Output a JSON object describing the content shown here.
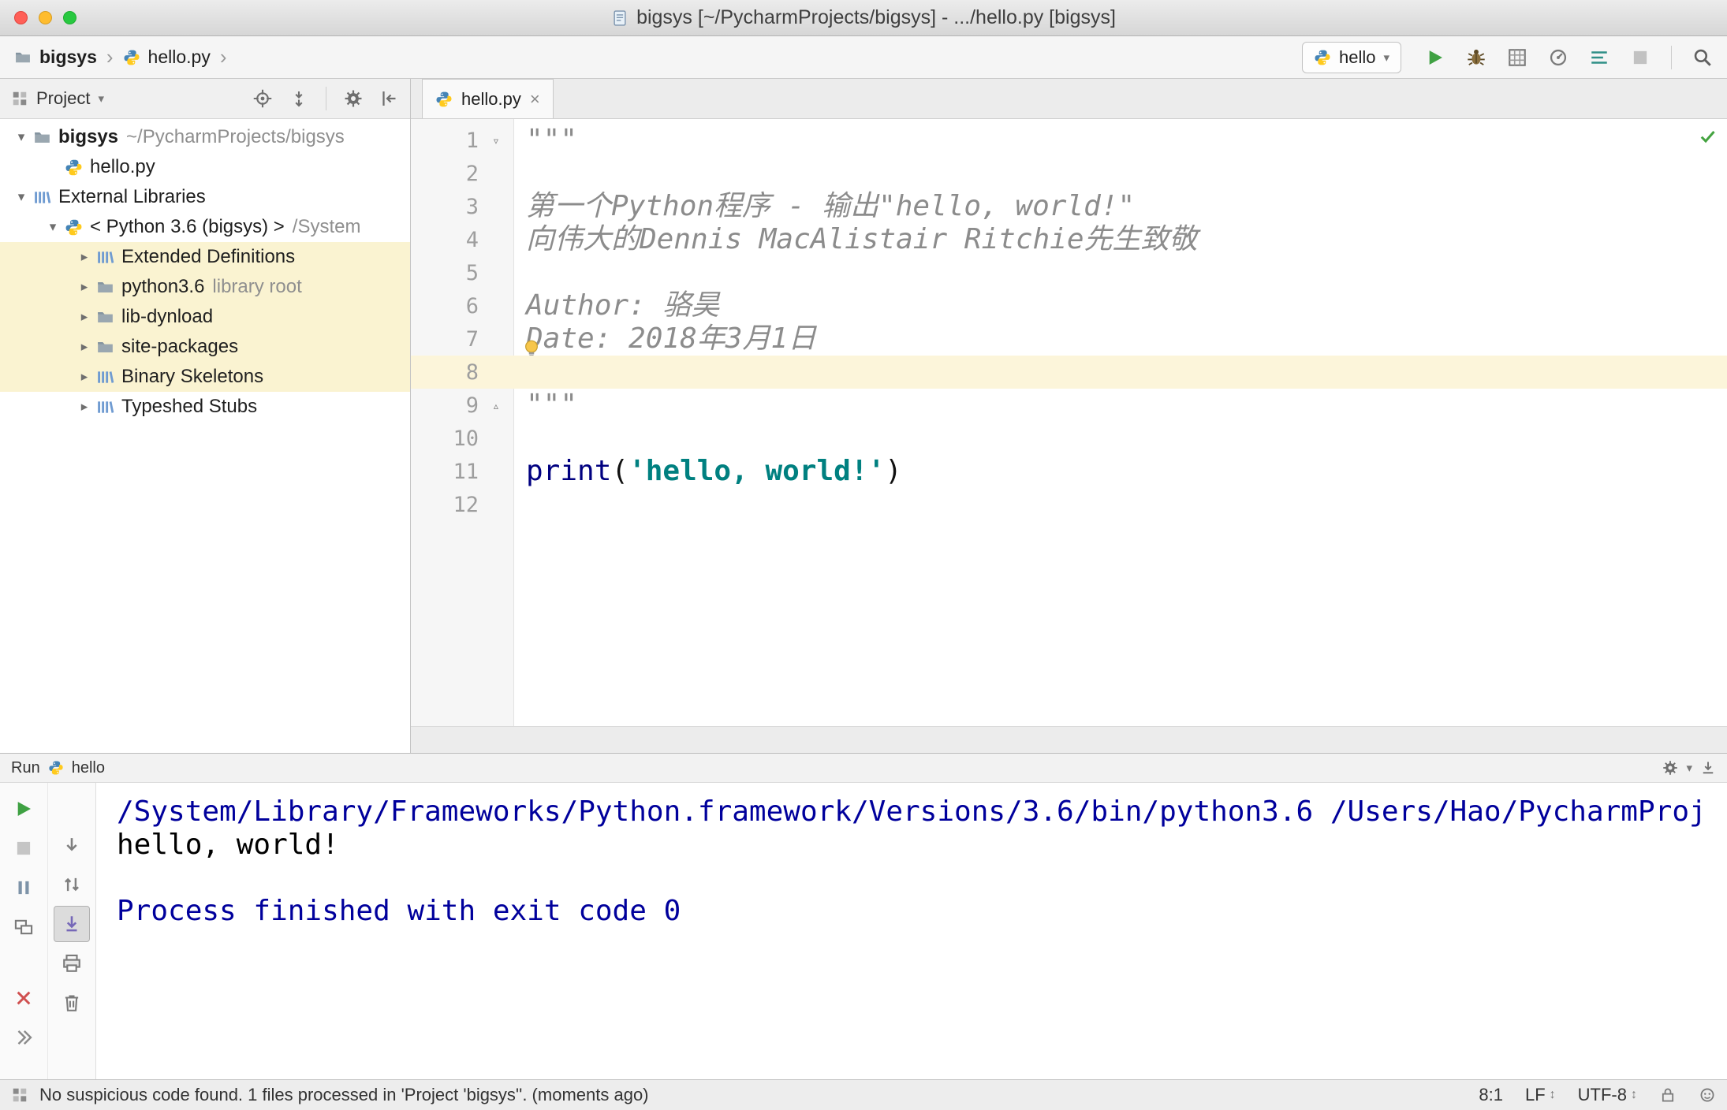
{
  "window": {
    "title": "bigsys [~/PycharmProjects/bigsys] - .../hello.py [bigsys]"
  },
  "navbar": {
    "breadcrumbs": {
      "project": "bigsys",
      "file": "hello.py"
    },
    "run_config": "hello"
  },
  "project_panel": {
    "title": "Project",
    "tree": [
      {
        "indent": 0,
        "arrow": "down",
        "icon": "folder",
        "label": "bigsys",
        "bold": true,
        "suffix": "~/PycharmProjects/bigsys"
      },
      {
        "indent": 1,
        "arrow": "none",
        "icon": "python",
        "label": "hello.py"
      },
      {
        "indent": 0,
        "arrow": "down",
        "icon": "library",
        "label": "External Libraries"
      },
      {
        "indent": 1,
        "arrow": "down",
        "icon": "python",
        "label": "< Python 3.6 (bigsys) >",
        "suffix": "/System"
      },
      {
        "indent": 2,
        "arrow": "right",
        "icon": "library",
        "label": "Extended Definitions",
        "highlight": true
      },
      {
        "indent": 2,
        "arrow": "right",
        "icon": "folder",
        "label": "python3.6",
        "suffix": "library root",
        "highlight": true
      },
      {
        "indent": 2,
        "arrow": "right",
        "icon": "folder",
        "label": "lib-dynload",
        "highlight": true
      },
      {
        "indent": 2,
        "arrow": "right",
        "icon": "folder",
        "label": "site-packages",
        "highlight": true
      },
      {
        "indent": 2,
        "arrow": "right",
        "icon": "library",
        "label": "Binary Skeletons",
        "highlight": true
      },
      {
        "indent": 2,
        "arrow": "right",
        "icon": "library",
        "label": "Typeshed Stubs"
      }
    ]
  },
  "editor": {
    "tab": "hello.py",
    "lines": [
      {
        "n": "1",
        "fold": "down",
        "segs": [
          {
            "t": "\"\"\"",
            "s": "doc"
          }
        ]
      },
      {
        "n": "2",
        "segs": []
      },
      {
        "n": "3",
        "segs": [
          {
            "t": "第一个Python程序 - 输出\"hello, world!\"",
            "s": "doc"
          }
        ]
      },
      {
        "n": "4",
        "segs": [
          {
            "t": "向伟大的Dennis MacAlistair Ritchie先生致敬",
            "s": "doc"
          }
        ]
      },
      {
        "n": "5",
        "segs": []
      },
      {
        "n": "6",
        "segs": [
          {
            "t": "Author: 骆昊",
            "s": "doc"
          }
        ]
      },
      {
        "n": "7",
        "segs": [
          {
            "t": "Date: 2018年3月1日",
            "s": "doc"
          }
        ],
        "bulb": true
      },
      {
        "n": "8",
        "segs": [],
        "current": true
      },
      {
        "n": "9",
        "fold": "up",
        "segs": [
          {
            "t": "\"\"\"",
            "s": "doc"
          }
        ]
      },
      {
        "n": "10",
        "segs": []
      },
      {
        "n": "11",
        "segs": [
          {
            "t": "print",
            "s": "kw"
          },
          {
            "t": "(",
            "s": "pln"
          },
          {
            "t": "'hello, world!'",
            "s": "str"
          },
          {
            "t": ")",
            "s": "pln"
          }
        ]
      },
      {
        "n": "12",
        "segs": []
      }
    ]
  },
  "run_panel": {
    "title": "Run",
    "config": "hello",
    "console": [
      {
        "s": "sys",
        "t": "/System/Library/Frameworks/Python.framework/Versions/3.6/bin/python3.6 /Users/Hao/PycharmProj"
      },
      {
        "s": "out",
        "t": "hello, world!"
      },
      {
        "s": "out",
        "t": ""
      },
      {
        "s": "sys",
        "t": "Process finished with exit code 0"
      }
    ]
  },
  "status_bar": {
    "message": "No suspicious code found. 1 files processed in 'Project 'bigsys''. (moments ago)",
    "caret": "8:1",
    "line_sep": "LF",
    "encoding": "UTF-8"
  }
}
